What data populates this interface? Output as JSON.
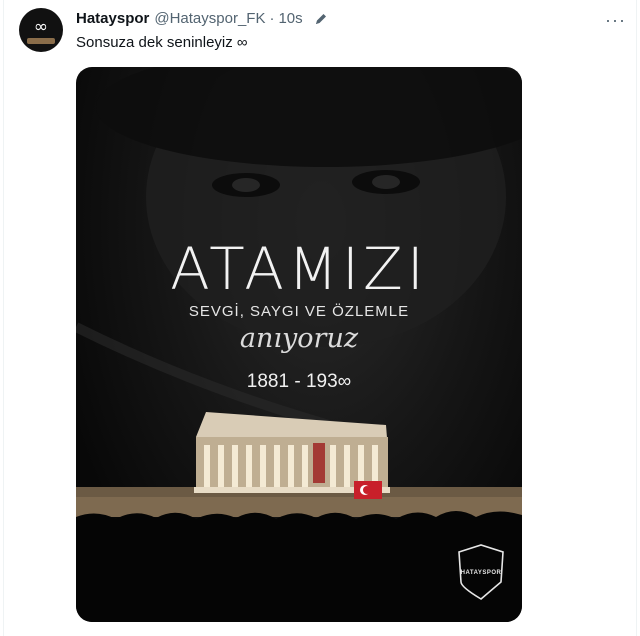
{
  "tweet": {
    "author_name": "Hatayspor",
    "handle": "@Hatayspor_FK",
    "separator": "·",
    "time": "10s",
    "text": "Sonsuza dek seninleyiz ∞"
  },
  "poster": {
    "title": "ATAMIZI",
    "subtitle": "SEVGİ, SAYGI VE ÖZLEMLE",
    "script": "anıyoruz",
    "years": "1881 - 193∞",
    "club_label": "HATAYSPOR"
  },
  "icons": {
    "avatar": "infinity-avatar",
    "edit": "pencil-icon",
    "more": "more-icon",
    "crest": "club-crest-icon"
  },
  "colors": {
    "text_primary": "#0f1419",
    "text_secondary": "#536471",
    "poster_bg": "#0b0b0b"
  }
}
